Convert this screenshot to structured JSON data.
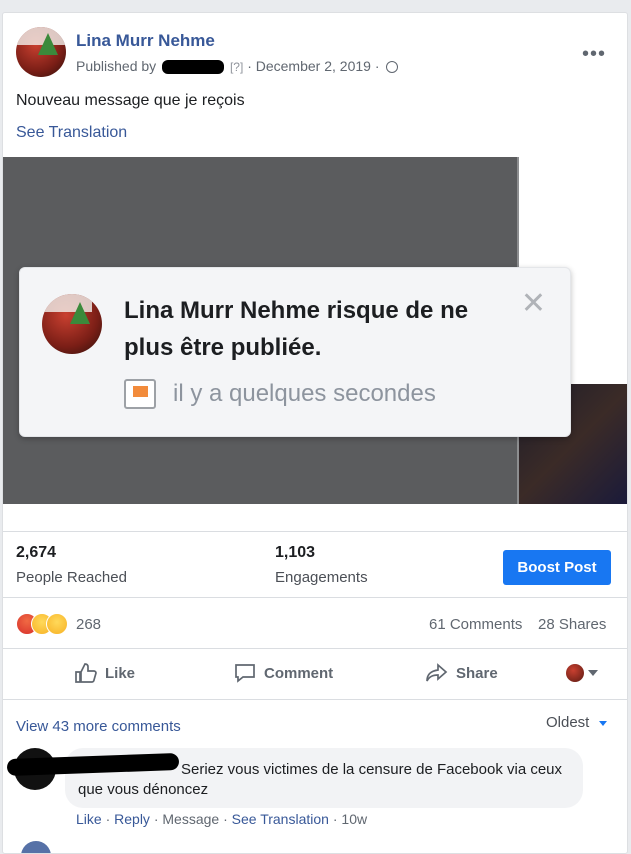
{
  "post": {
    "author": "Lina Murr Nehme",
    "published_by": "Published by",
    "help_marker": "[?]",
    "separator": "·",
    "date": "December 2, 2019",
    "text": "Nouveau message que je reçois",
    "see_translation": "See Translation",
    "more_icon": "ellipsis-icon",
    "privacy_icon": "globe-icon"
  },
  "notification": {
    "title": "Lina Murr Nehme risque de ne plus être publiée.",
    "time": "il y a quelques secondes",
    "close_icon": "close-icon",
    "flag_icon": "flag-icon"
  },
  "insights": {
    "reached_value": "2,674",
    "reached_label": "People Reached",
    "engagements_value": "1,103",
    "engagements_label": "Engagements",
    "boost_label": "Boost Post",
    "boost_color": "#1877f2"
  },
  "reactions": {
    "icons": [
      "angry-icon",
      "wow-icon",
      "sad-icon"
    ],
    "count": "268",
    "comments": "61 Comments",
    "shares": "28 Shares"
  },
  "actions": {
    "like": "Like",
    "comment": "Comment",
    "share": "Share"
  },
  "comments": {
    "view_more": "View 43 more comments",
    "sort": "Oldest",
    "first": {
      "text": "Seriez vous victimes de la censure de Facebook via ceux que vous dénoncez",
      "like": "Like",
      "reply": "Reply",
      "message": "Message",
      "see_translation": "See Translation",
      "age": "10w"
    }
  },
  "colors": {
    "link": "#385898",
    "accent": "#1877f2",
    "text_secondary": "#606770"
  }
}
